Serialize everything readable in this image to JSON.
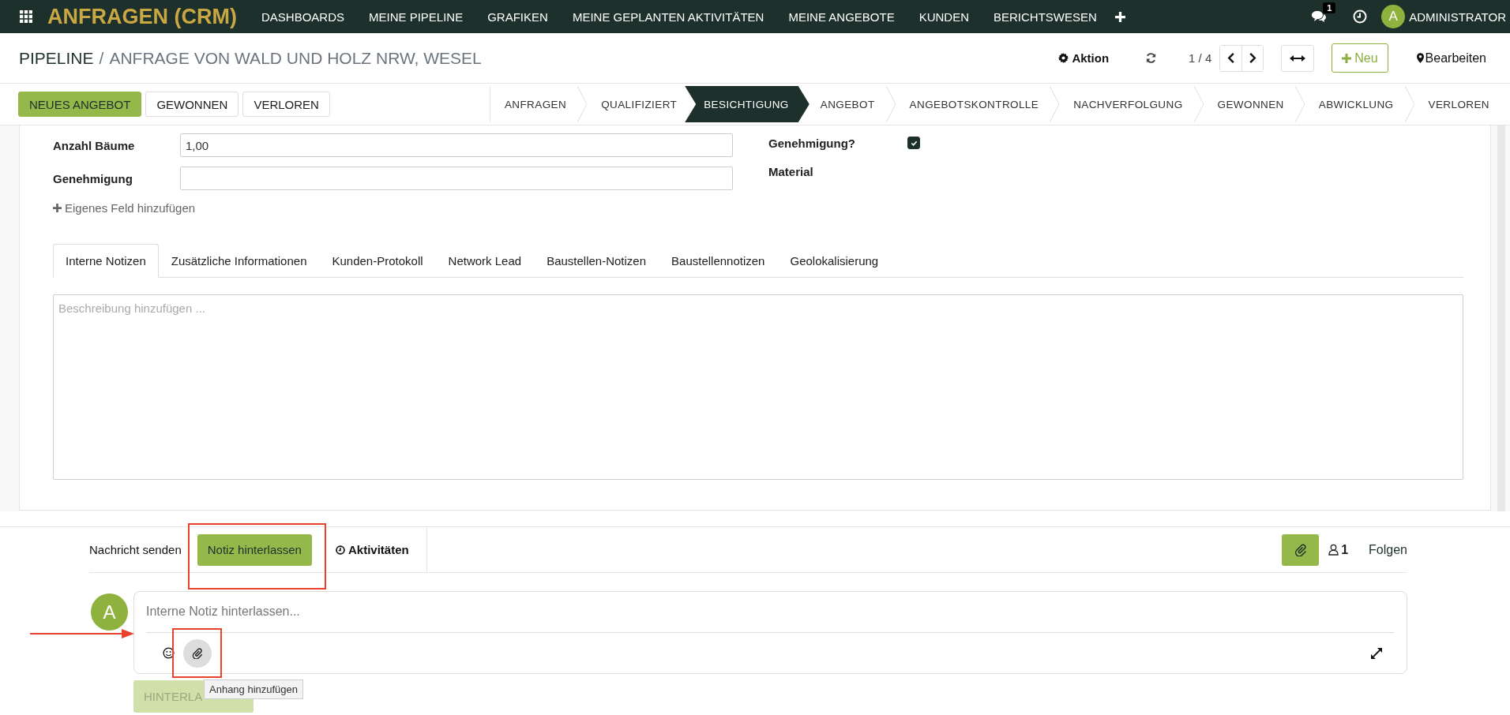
{
  "app": {
    "title": "ANFRAGEN (CRM)"
  },
  "nav": {
    "items": [
      "DASHBOARDS",
      "MEINE PIPELINE",
      "GRAFIKEN",
      "MEINE GEPLANTEN AKTIVITÄTEN",
      "MEINE ANGEBOTE",
      "KUNDEN",
      "BERICHTSWESEN"
    ],
    "chat_count": "1",
    "user": {
      "initial": "A",
      "name": "ADMINISTRATOR"
    }
  },
  "breadcrumb": {
    "parent": "PIPELINE",
    "separator": "/",
    "current": "ANFRAGE VON WALD UND HOLZ NRW, WESEL"
  },
  "control_panel": {
    "action": "Aktion",
    "pager": "1 / 4",
    "new": "Neu",
    "edit": "Bearbeiten"
  },
  "header_buttons": [
    {
      "label": "NEUES ANGEBOT",
      "primary": true
    },
    {
      "label": "GEWONNEN",
      "primary": false
    },
    {
      "label": "VERLOREN",
      "primary": false
    }
  ],
  "stages": [
    {
      "label": "ANFRAGEN",
      "selected": false
    },
    {
      "label": "QUALIFIZIERT",
      "selected": false
    },
    {
      "label": "BESICHTIGUNG",
      "selected": true
    },
    {
      "label": "ANGEBOT",
      "selected": false
    },
    {
      "label": "ANGEBOTSKONTROLLE",
      "selected": false
    },
    {
      "label": "NACHVERFOLGUNG",
      "selected": false
    },
    {
      "label": "GEWONNEN",
      "selected": false
    },
    {
      "label": "ABWICKLUNG",
      "selected": false
    },
    {
      "label": "VERLOREN",
      "selected": false
    }
  ],
  "fields_left": [
    {
      "label": "Anzahl Bäume",
      "value": "1,00"
    },
    {
      "label": "Genehmigung"
    }
  ],
  "fields_right": [
    {
      "label": "Genehmigung?",
      "kind": "checkbox",
      "checked": true
    },
    {
      "label": "Material",
      "kind": "text"
    }
  ],
  "add_field": "Eigenes Feld hinzufügen",
  "tabs": [
    {
      "label": "Interne Notizen",
      "selected": true
    },
    {
      "label": "Zusätzliche Informationen",
      "selected": false
    },
    {
      "label": "Kunden-Protokoll",
      "selected": false
    },
    {
      "label": "Network Lead",
      "selected": false
    },
    {
      "label": "Baustellen-Notizen",
      "selected": false
    },
    {
      "label": "Baustellennotizen",
      "selected": false
    },
    {
      "label": "Geolokalisierung",
      "selected": false
    }
  ],
  "notes": {
    "placeholder": "Beschreibung hinzufügen ..."
  },
  "chatter": {
    "modes": [
      {
        "label": "Nachricht senden",
        "selected": false
      },
      {
        "label": "Notiz hinterlassen",
        "selected": true
      }
    ],
    "activities": "Aktivitäten",
    "followers": "1",
    "follow": "Folgen",
    "composer": {
      "avatar": "A",
      "placeholder": "Interne Notiz hinterlassen...",
      "submit": "HINTERLA",
      "submit_disabled": true,
      "tooltip": "Anhang hinzufügen"
    }
  }
}
